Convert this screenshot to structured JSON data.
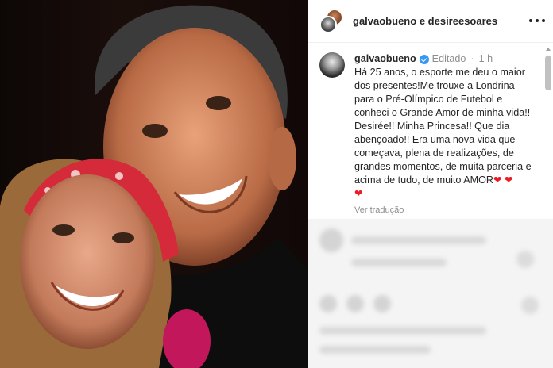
{
  "photo": {
    "description_icon": "couple-photo"
  },
  "header": {
    "user1": "galvaobueno",
    "separator": "e",
    "user2": "desireesoares"
  },
  "caption": {
    "username": "galvaobueno",
    "edited": "Editado",
    "dot": "·",
    "time": "1 h",
    "text": "Há 25 anos, o esporte me deu o maior dos presentes!Me trouxe a Londrina para o Pré-Olímpico de Futebol e conheci o Grande Amor de minha vida!! Desirée!! Minha Princesa!! Que dia abençoado!! Era uma nova vida que começava, plena de realizações, de grandes momentos, de muita parceria e acima de tudo, de muito AMOR",
    "hearts": "❤ ❤",
    "heart_last": "❤",
    "see_translation": "Ver tradução"
  },
  "colors": {
    "verified": "#3897f0",
    "heart": "#ed1c24",
    "muted": "#8e8e8e"
  }
}
